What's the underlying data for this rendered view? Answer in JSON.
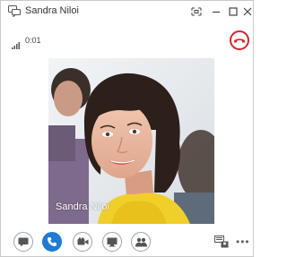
{
  "window": {
    "title": "Sandra Niloi",
    "icon": "lync-chat-icon",
    "controls": [
      "pin-icon",
      "minimize-icon",
      "maximize-icon",
      "close-icon"
    ]
  },
  "status": {
    "signal_icon": "signal-bars-icon",
    "timer": "0:01",
    "hangup_icon": "hang-up-icon",
    "hangup_color": "#d9242b"
  },
  "video": {
    "caller_name": "Sandra Niloi"
  },
  "toolbar": {
    "buttons": [
      {
        "icon": "im-icon",
        "active": false
      },
      {
        "icon": "phone-icon",
        "active": true
      },
      {
        "icon": "video-camera-icon",
        "active": false
      },
      {
        "icon": "present-icon",
        "active": false
      },
      {
        "icon": "participants-icon",
        "active": false
      }
    ],
    "layout_icon": "layout-icon",
    "more_label": "•••",
    "accent_color": "#1f7bd6"
  }
}
